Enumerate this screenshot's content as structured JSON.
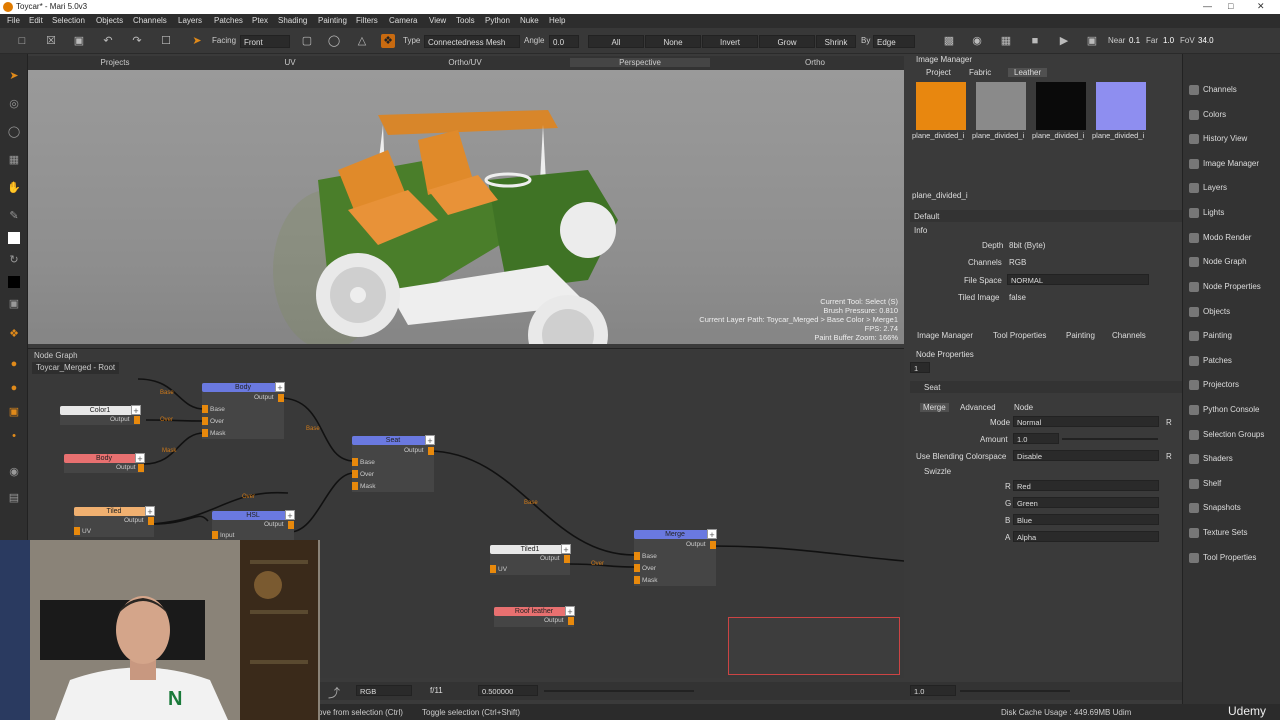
{
  "window": {
    "title": "Toycar* - Mari 5.0v3"
  },
  "menu": [
    "File",
    "Edit",
    "Selection",
    "Objects",
    "Channels",
    "Layers",
    "Patches",
    "Ptex",
    "Shading",
    "Painting",
    "Filters",
    "Camera",
    "View",
    "Tools",
    "Python",
    "Nuke",
    "Help"
  ],
  "toolbar": {
    "facing_label": "Facing",
    "facing_value": "Front",
    "type_label": "Type",
    "type_value": "Connectedness Mesh",
    "angle_label": "Angle",
    "angle_value": "0.0",
    "all": "All",
    "none": "None",
    "invert": "Invert",
    "grow": "Grow",
    "shrink": "Shrink",
    "by_label": "By",
    "by_value": "Edge",
    "near_label": "Near",
    "near_value": "0.1",
    "far_label": "Far",
    "far_value": "1.0",
    "fov_label": "FoV",
    "fov_value": "34.0"
  },
  "view_tabs": [
    "Projects",
    "UV",
    "Ortho/UV",
    "Perspective",
    "Ortho"
  ],
  "viewport_info": [
    "Current Tool: Select (S)",
    "Brush Pressure: 0.810",
    "Current Layer Path: Toycar_Merged > Base Color > Merge1",
    "FPS: 2.74",
    "Paint Buffer Zoom: 166%"
  ],
  "node_graph": {
    "title": "Node Graph",
    "breadcrumb": "Toycar_Merged - Root",
    "nodes": {
      "body1": "Body",
      "color1": "Color1",
      "body2": "Body",
      "tiled": "Tiled",
      "hsl": "HSL",
      "seat": "Seat",
      "tiled1": "Tiled1",
      "merge": "Merge",
      "roofleather": "Roof leather"
    },
    "ports": {
      "output": "Output",
      "base": "Base",
      "over": "Over",
      "mask": "Mask",
      "uv": "UV",
      "input": "Input"
    }
  },
  "image_manager": {
    "title": "Image Manager",
    "tabs": [
      "Project",
      "Fabric",
      "Leather"
    ],
    "images": [
      {
        "label": "plane_divided_i",
        "color": "#e8870f"
      },
      {
        "label": "plane_divided_i",
        "color": "#8a8a8a"
      },
      {
        "label": "plane_divided_i",
        "color": "#0a0a0a"
      },
      {
        "label": "plane_divided_i",
        "color": "#8e8ef0"
      }
    ],
    "extra_label": "plane_divided_i",
    "default_section": "Default",
    "info_section": "Info",
    "depth_label": "Depth",
    "depth_value": "8bit (Byte)",
    "channels_label": "Channels",
    "channels_value": "RGB",
    "filespace_label": "File Space",
    "filespace_value": "NORMAL",
    "tiled_label": "Tiled Image",
    "tiled_value": "false",
    "bottom_tabs": [
      "Image Manager",
      "Tool Properties",
      "Painting",
      "Channels"
    ]
  },
  "node_properties": {
    "title": "Node Properties",
    "count": "1",
    "node_name": "Seat",
    "tabs": [
      "Merge",
      "Advanced",
      "Node"
    ],
    "mode_label": "Mode",
    "mode_value": "Normal",
    "amount_label": "Amount",
    "amount_value": "1.0",
    "blend_label": "Use Blending Colorspace",
    "blend_value": "Disable",
    "swizzle_label": "Swizzle",
    "swizzle": [
      {
        "ch": "R",
        "val": "Red"
      },
      {
        "ch": "G",
        "val": "Green"
      },
      {
        "ch": "B",
        "val": "Blue"
      },
      {
        "ch": "A",
        "val": "Alpha"
      }
    ],
    "r_btn": "R"
  },
  "right_panel": [
    "Channels",
    "Colors",
    "History View",
    "Image Manager",
    "Layers",
    "Lights",
    "Modo Render",
    "Node Graph",
    "Node Properties",
    "Objects",
    "Painting",
    "Patches",
    "Projectors",
    "Python Console",
    "Selection Groups",
    "Shaders",
    "Shelf",
    "Snapshots",
    "Texture Sets",
    "Tool Properties"
  ],
  "bottom_bar": {
    "mode": "RGB",
    "frame": "f/11",
    "value": "0.500000",
    "right_value": "1.0"
  },
  "status": {
    "left1": "ove from selection (Ctrl)",
    "left2": "Toggle selection (Ctrl+Shift)",
    "cache": "Disk Cache Usage : 449.69MB Udim",
    "brand": "Udemy"
  }
}
